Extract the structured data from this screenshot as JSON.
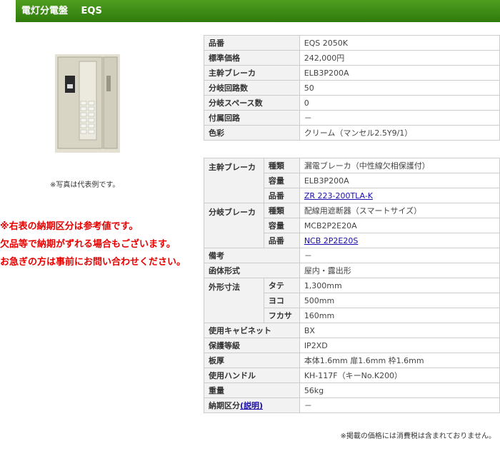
{
  "header": {
    "title": "電灯分電盤",
    "series": "EQS"
  },
  "photo": {
    "caption": "※写真は代表例です。"
  },
  "notice": [
    "※右表の納期区分は参考値です。",
    "欠品等で納期がずれる場合もございます。",
    "お急ぎの方は事前にお問い合わせください。"
  ],
  "spec1": [
    {
      "label": "品番",
      "value": "EQS 2050K"
    },
    {
      "label": "標準価格",
      "value": "242,000円"
    },
    {
      "label": "主幹ブレーカ",
      "value": "ELB3P200A"
    },
    {
      "label": "分岐回路数",
      "value": "50"
    },
    {
      "label": "分岐スペース数",
      "value": "0"
    },
    {
      "label": "付属回路",
      "value": "－"
    },
    {
      "label": "色彩",
      "value": "クリーム（マンセル2.5Y9/1）"
    }
  ],
  "spec2": {
    "main": {
      "label": "主幹ブレーカ",
      "kind_label": "種類",
      "kind": "漏電ブレーカ（中性線欠相保護付）",
      "cap_label": "容量",
      "cap": "ELB3P200A",
      "part_label": "品番",
      "part": "ZR 223-200TLA-K"
    },
    "branch": {
      "label": "分岐ブレーカ",
      "kind_label": "種類",
      "kind": "配線用遮断器（スマートサイズ）",
      "cap_label": "容量",
      "cap": "MCB2P2E20A",
      "part_label": "品番",
      "part": "NCB 2P2E20S"
    },
    "remarks": {
      "label": "備考",
      "value": "－"
    },
    "case": {
      "label": "函体形式",
      "value": "屋内・露出形"
    },
    "dims": {
      "label": "外形寸法",
      "h_label": "タテ",
      "h": "1,300mm",
      "w_label": "ヨコ",
      "w": "500mm",
      "d_label": "フカサ",
      "d": "160mm"
    },
    "cabinet": {
      "label": "使用キャビネット",
      "value": "BX"
    },
    "protection": {
      "label": "保護等級",
      "value": "IP2XD"
    },
    "thickness": {
      "label": "板厚",
      "value": "本体1.6mm 扉1.6mm 枠1.6mm"
    },
    "handle": {
      "label": "使用ハンドル",
      "value": "KH-117F（キーNo.K200）"
    },
    "weight": {
      "label": "重量",
      "value": "56kg"
    },
    "delivery": {
      "label": "納期区分",
      "link": "(説明)",
      "value": "－"
    }
  },
  "footnote": "※掲載の価格には消費税は含まれておりません。"
}
